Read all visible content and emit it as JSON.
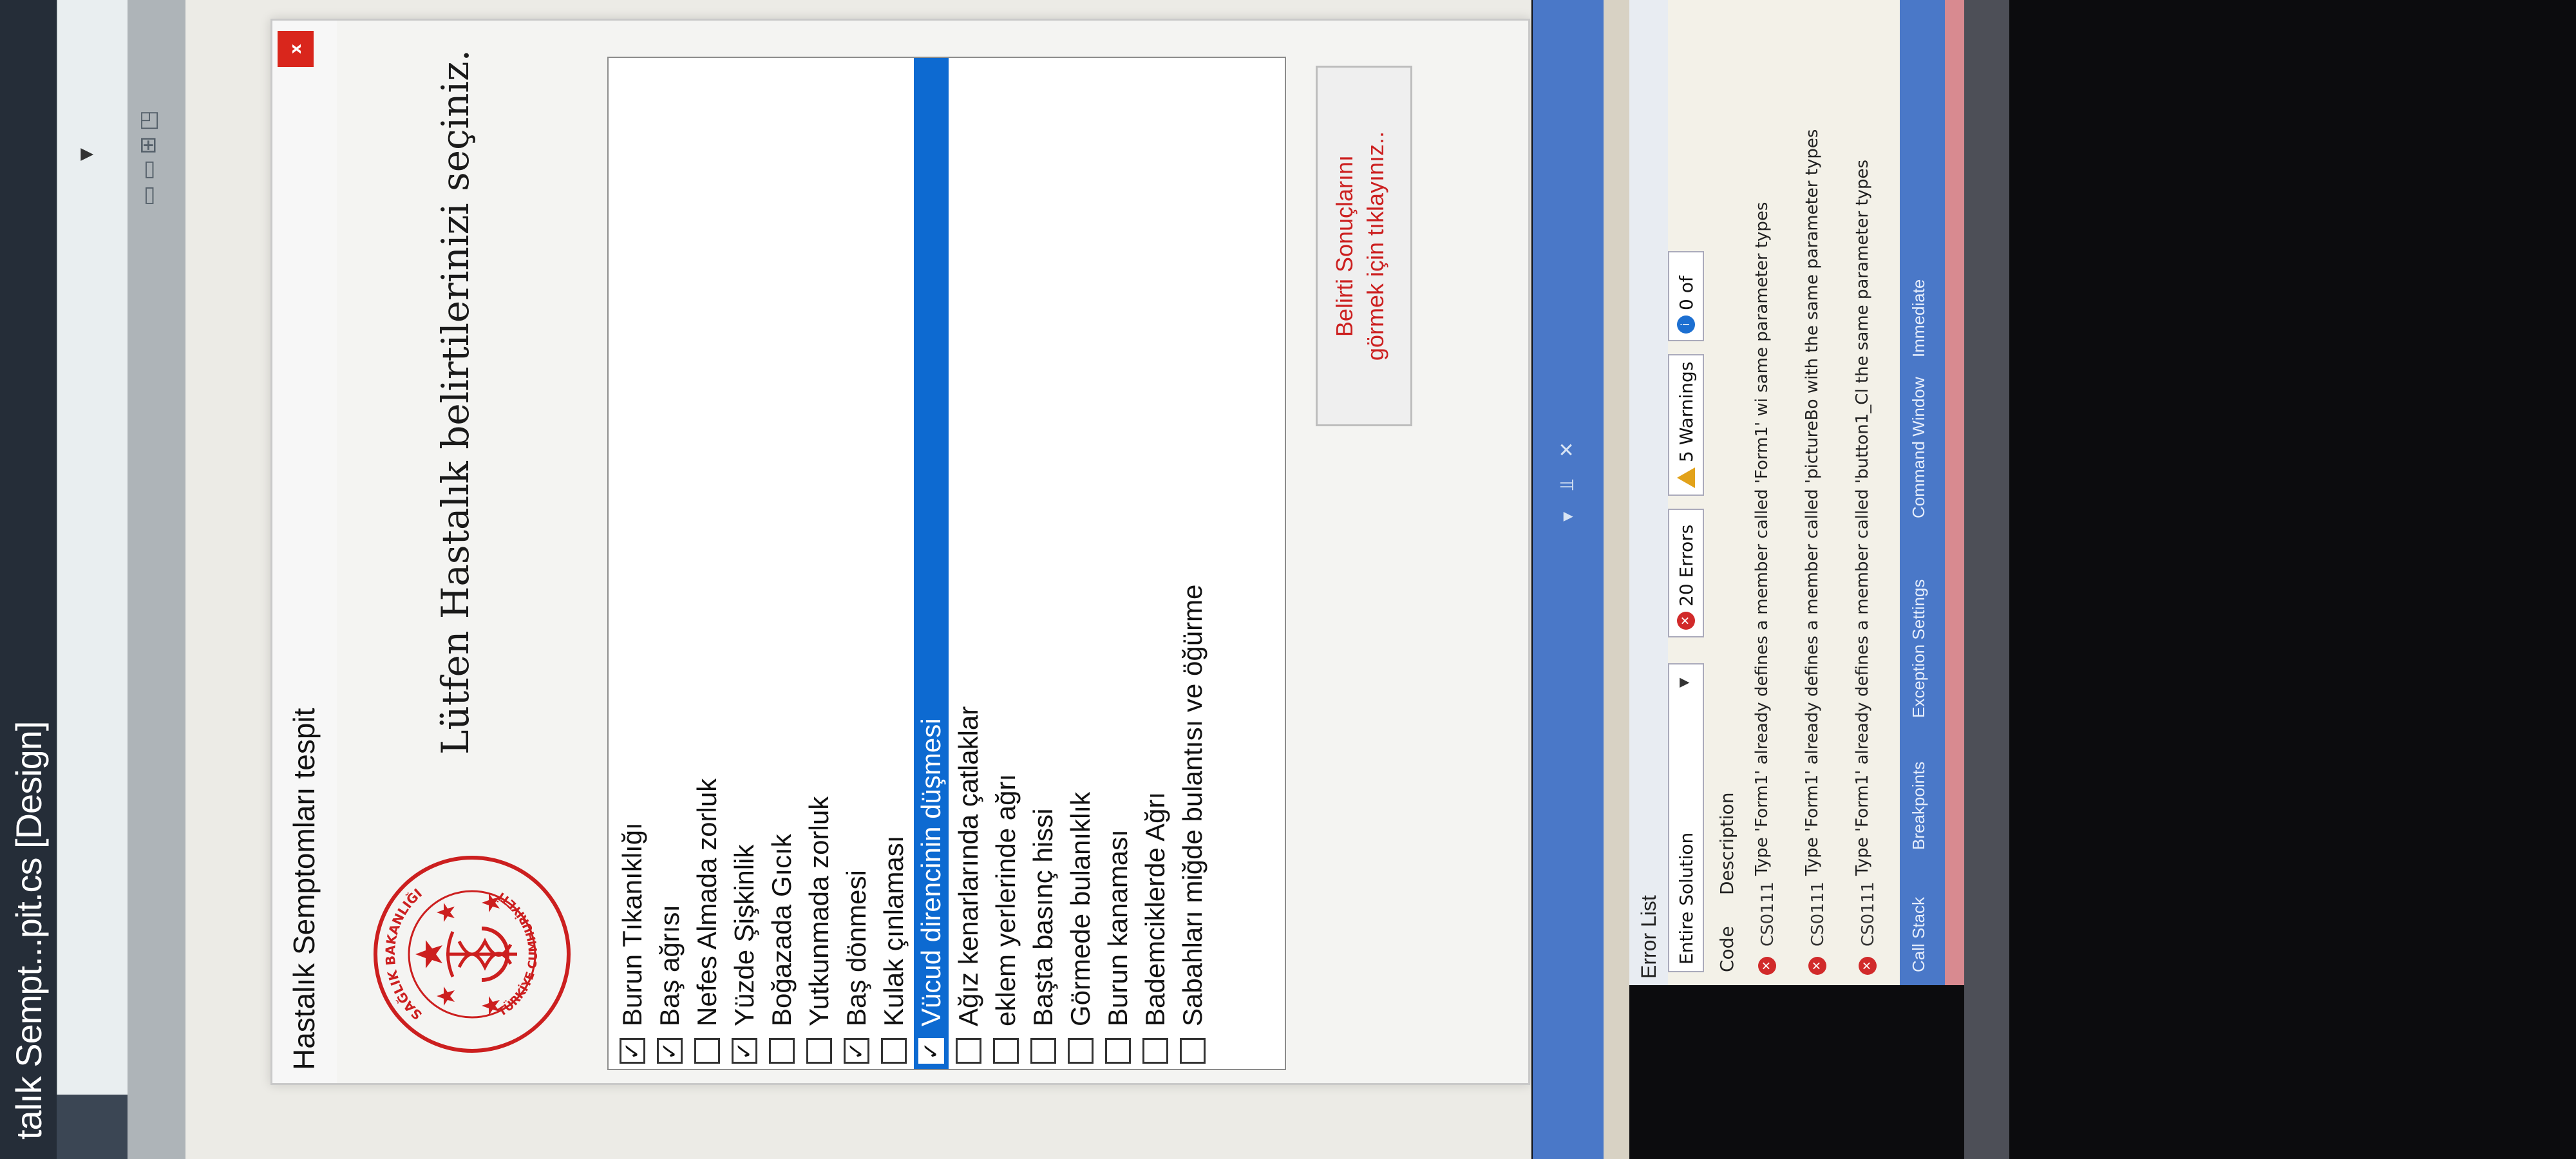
{
  "ide": {
    "title": "talık Sempt...pit.cs [Design]"
  },
  "form": {
    "title": "Hastalık Semptomları tespit",
    "close_glyph": "x",
    "heading": "Lütfen Hastalık belirtilerinizi seçiniz.",
    "logo": {
      "top_text": "SAĞLIK BAKANLIĞI",
      "bottom_text": "TÜRKİYE CUMHURİYETİ",
      "accent": "#cc1f1f"
    },
    "symptoms": [
      {
        "label": "Burun Tıkanıklığı",
        "check": "✓"
      },
      {
        "label": "Baş ağrısı",
        "check": "✓"
      },
      {
        "label": "Nefes Almada zorluk",
        "check": ""
      },
      {
        "label": "Yüzde Şişkinlik",
        "check": "✓"
      },
      {
        "label": "Boğazada Gıcık",
        "check": ""
      },
      {
        "label": "Yutkunmada zorluk",
        "check": ""
      },
      {
        "label": "Baş dönmesi",
        "check": "✓"
      },
      {
        "label": "Kulak çınlaması",
        "check": ""
      },
      {
        "label": "Vücud direncinin düşmesi",
        "check": "✓"
      },
      {
        "label": "Ağız kenarlarında çatlaklar",
        "check": ""
      },
      {
        "label": "eklem yerlerinde ağrı",
        "check": ""
      },
      {
        "label": "Başta basınç hissi",
        "check": ""
      },
      {
        "label": "Görmede bulanıklık",
        "check": ""
      },
      {
        "label": "Burun kanaması",
        "check": ""
      },
      {
        "label": "Bademciklerde Ağrı",
        "check": ""
      },
      {
        "label": "Sabahları miğde bulantısı ve öğürme",
        "check": ""
      }
    ],
    "selected_index": 8,
    "result_button": {
      "line1": "Belirti Sonuçlarını",
      "line2": "görmek için tıklayınız.."
    }
  },
  "error_list": {
    "title": "Error List",
    "scope": "Entire Solution",
    "errors_label": "20 Errors",
    "warnings_label": "5 Warnings",
    "messages_label": "0 of",
    "col_code": "Code",
    "col_description": "Description",
    "rows": [
      {
        "code": "CS0111",
        "description": "Type 'Form1' already defines a member called 'Form1' wi same parameter types"
      },
      {
        "code": "CS0111",
        "description": "Type 'Form1' already defines a member called 'pictureBo with the same parameter types"
      },
      {
        "code": "CS0111",
        "description": "Type 'Form1' already defines a member called 'button1_Cl the same parameter types"
      }
    ]
  },
  "panel_tabs_glyphs": "▾ ⫫ ✕",
  "bottom_tabs": [
    "Call Stack",
    "Breakpoints",
    "Exception Settings",
    "Command Window",
    "Immediate"
  ]
}
